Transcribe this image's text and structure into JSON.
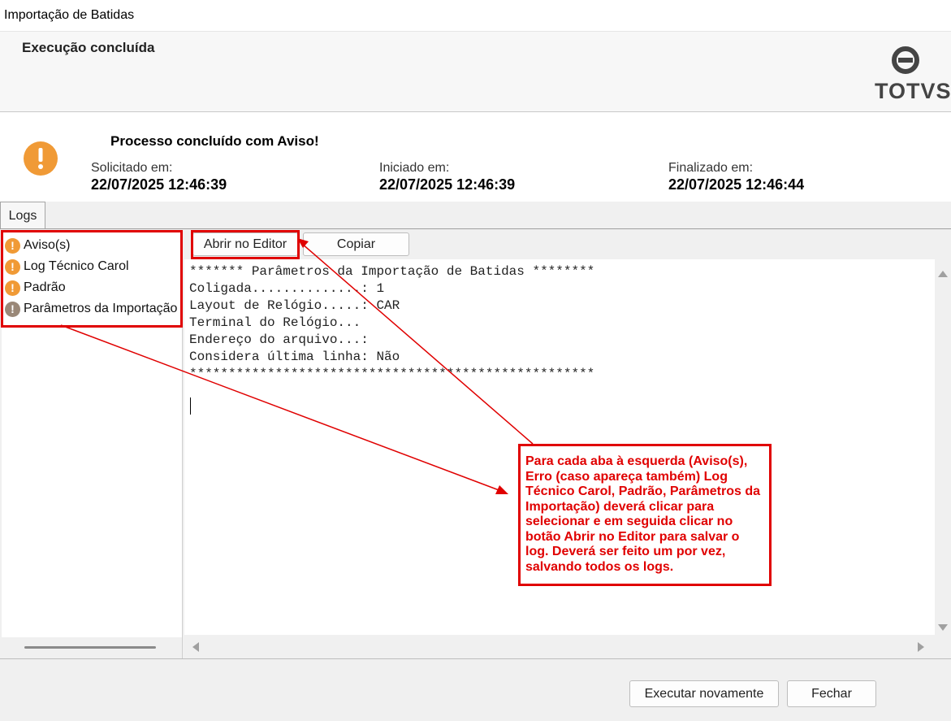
{
  "window": {
    "title": "Importação de Batidas"
  },
  "header": {
    "status_title": "Execução concluída",
    "logo_text": "TOTVS",
    "logo_icon": "totvs-logo-icon"
  },
  "status": {
    "message": "Processo concluído com Aviso!",
    "icon": "warning-icon",
    "requested": {
      "label": "Solicitado em:",
      "value": "22/07/2025 12:46:39"
    },
    "started": {
      "label": "Iniciado em:",
      "value": "22/07/2025 12:46:39"
    },
    "finished": {
      "label": "Finalizado em:",
      "value": "22/07/2025 12:46:44"
    }
  },
  "tabs": [
    {
      "label": "Logs",
      "selected": true
    }
  ],
  "log_list": [
    {
      "label": "Aviso(s)",
      "icon": "warning-icon",
      "color": "#f09a36"
    },
    {
      "label": "Log Técnico Carol",
      "icon": "warning-icon",
      "color": "#f09a36"
    },
    {
      "label": "Padrão",
      "icon": "warning-icon",
      "color": "#f09a36"
    },
    {
      "label": "Parâmetros da Importação",
      "icon": "info-icon",
      "color": "#9a8878"
    }
  ],
  "toolbar": {
    "open_editor": "Abrir no Editor",
    "copy": "Copiar"
  },
  "log_text": [
    "******* Parâmetros da Importação de Batidas ********",
    "Coligada..............: 1",
    "Layout de Relógio.....: CAR",
    "Terminal do Relógio...",
    "Endereço do arquivo...:",
    "Considera última linha: Não",
    "****************************************************"
  ],
  "footer": {
    "run_again": "Executar novamente",
    "close": "Fechar"
  },
  "annotation": {
    "text": "Para cada aba à esquerda (Aviso(s), Erro (caso apareça também) Log Técnico Carol, Padrão, Parâmetros da Importação) deverá clicar para selecionar e em seguida clicar no botão Abrir no Editor para salvar o log. Deverá ser feito um por vez, salvando todos os logs.",
    "color": "#e00000"
  }
}
